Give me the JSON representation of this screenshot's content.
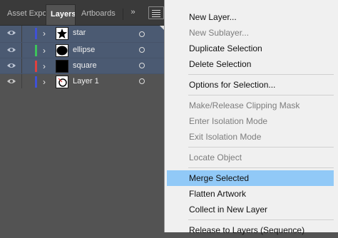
{
  "tabs": [
    {
      "label": "Asset Expo",
      "active": false
    },
    {
      "label": "Layers",
      "active": true
    },
    {
      "label": "Artboards",
      "active": false
    }
  ],
  "overflow_glyph": "››",
  "layers": [
    {
      "name": "star",
      "color": "#3f51d6",
      "thumb": "star",
      "selected": true
    },
    {
      "name": "ellipse",
      "color": "#3cc55a",
      "thumb": "ellipse",
      "selected": true
    },
    {
      "name": "square",
      "color": "#e0413f",
      "thumb": "square",
      "selected": true
    },
    {
      "name": "Layer 1",
      "color": "#3f51d6",
      "thumb": "layer",
      "selected": false
    }
  ],
  "menu": {
    "items": [
      {
        "label": "New Layer...",
        "enabled": true
      },
      {
        "label": "New Sublayer...",
        "enabled": false
      },
      {
        "label": "Duplicate Selection",
        "enabled": true
      },
      {
        "label": "Delete Selection",
        "enabled": true
      },
      {
        "separator": true
      },
      {
        "label": "Options for Selection...",
        "enabled": true
      },
      {
        "separator": true
      },
      {
        "label": "Make/Release Clipping Mask",
        "enabled": false
      },
      {
        "label": "Enter Isolation Mode",
        "enabled": false
      },
      {
        "label": "Exit Isolation Mode",
        "enabled": false
      },
      {
        "separator": true
      },
      {
        "label": "Locate Object",
        "enabled": false
      },
      {
        "separator": true
      },
      {
        "label": "Merge Selected",
        "enabled": true,
        "highlighted": true
      },
      {
        "label": "Flatten Artwork",
        "enabled": true
      },
      {
        "label": "Collect in New Layer",
        "enabled": true
      },
      {
        "separator": true
      },
      {
        "label": "Release to Layers (Sequence)",
        "enabled": true
      }
    ]
  }
}
